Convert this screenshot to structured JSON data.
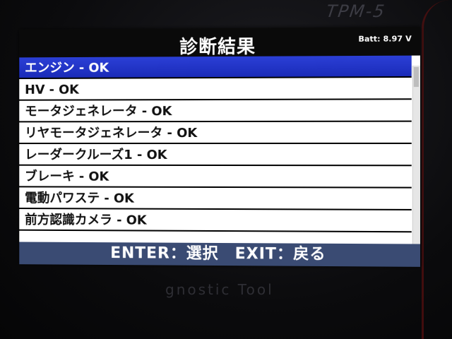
{
  "device": {
    "model_label": "TPM-5",
    "footer_label": "gnostic Tool"
  },
  "screen": {
    "title": "診断結果",
    "battery": "Batt: 8.97 V",
    "items": [
      {
        "label": "エンジン - OK",
        "selected": true
      },
      {
        "label": "HV - OK",
        "selected": false
      },
      {
        "label": "モータジェネレータ - OK",
        "selected": false
      },
      {
        "label": "リヤモータジェネレータ - OK",
        "selected": false
      },
      {
        "label": "レーダークルーズ1 - OK",
        "selected": false
      },
      {
        "label": "ブレーキ - OK",
        "selected": false
      },
      {
        "label": "電動パワステ - OK",
        "selected": false
      },
      {
        "label": "前方認識カメラ - OK",
        "selected": false
      }
    ],
    "footer": "ENTER：選択　EXIT：戻る"
  },
  "colors": {
    "selection": "#2b3fd6",
    "footer_bar": "#3a4b73",
    "title_bar": "#0a0a0a"
  }
}
